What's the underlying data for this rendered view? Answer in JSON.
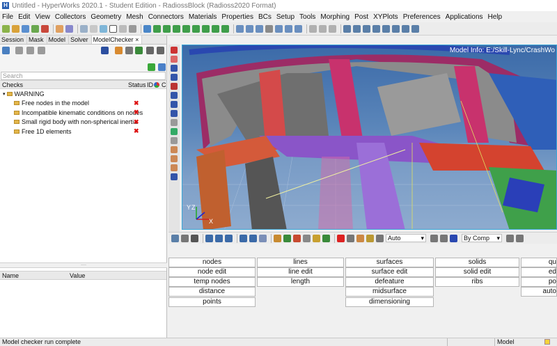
{
  "title_bar": {
    "title": "Untitled - HyperWorks 2020.1 - Student Edition - RadiossBlock (Radioss2020 Format)",
    "logo_glyph": "H"
  },
  "menu": [
    "File",
    "Edit",
    "View",
    "Collectors",
    "Geometry",
    "Mesh",
    "Connectors",
    "Materials",
    "Properties",
    "BCs",
    "Setup",
    "Tools",
    "Morphing",
    "Post",
    "XYPlots",
    "Preferences",
    "Applications",
    "Help"
  ],
  "browser_tabs": [
    "Session",
    "Mask",
    "Model",
    "Solver",
    "ModelChecker"
  ],
  "active_tab_close_glyph": "×",
  "search": {
    "placeholder": "Search"
  },
  "checks_table": {
    "headers": [
      "Checks",
      "Status",
      "ID",
      "C"
    ],
    "group": "WARNING",
    "items": [
      {
        "label": "Free nodes in the model",
        "status": "✖"
      },
      {
        "label": "Incompatible kinematic conditions on nodes",
        "status": "✖"
      },
      {
        "label": "Small rigid body with non-spherical inertia",
        "status": "✖"
      },
      {
        "label": "Free 1D elements",
        "status": "✖"
      }
    ]
  },
  "splitter_glyph": "....",
  "properties_table": {
    "headers": [
      "Name",
      "Value"
    ]
  },
  "graphics": {
    "model_info": "Model Info: E:/Skill-Lync/CrashWo",
    "axis_labels": [
      "Y",
      "Z",
      "X"
    ]
  },
  "bottom_toolbar": {
    "display_mode": "Auto",
    "color_mode": "By Comp"
  },
  "panel": {
    "col1": [
      "nodes",
      "node edit",
      "temp nodes",
      "distance",
      "points"
    ],
    "col2": [
      "lines",
      "line edit",
      "length"
    ],
    "col3": [
      "surfaces",
      "surface edit",
      "defeature",
      "midsurface",
      "dimensioning"
    ],
    "col4": [
      "solids",
      "solid edit",
      "ribs"
    ],
    "col5": [
      "qu",
      "ed",
      "po",
      "auto"
    ]
  },
  "status_bar": {
    "message": "Model checker run complete",
    "segment_label": "Model"
  },
  "colors": {
    "accent": "#2a5fb0",
    "status_error": "#d11111",
    "graphics_top": "#3b6aa8",
    "graphics_bottom": "#9fb8d6"
  }
}
